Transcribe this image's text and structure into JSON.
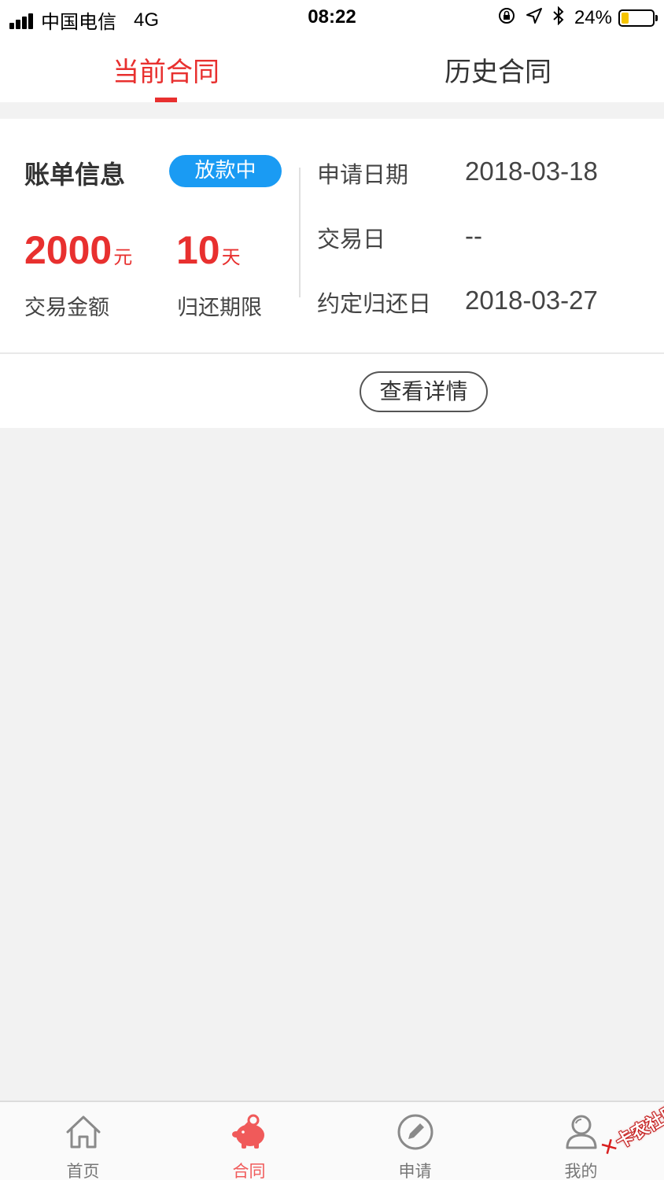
{
  "status_bar": {
    "carrier": "中国电信",
    "network": "4G",
    "time": "08:22",
    "battery_percent": "24%",
    "battery_level": 0.24
  },
  "tabs": [
    {
      "label": "当前合同",
      "active": true
    },
    {
      "label": "历史合同",
      "active": false
    }
  ],
  "bill": {
    "title": "账单信息",
    "status": "放款中",
    "amount_value": "2000",
    "amount_unit": "元",
    "amount_label": "交易金额",
    "term_value": "10",
    "term_unit": "天",
    "term_label": "归还期限",
    "info": [
      {
        "label": "申请日期",
        "value": "2018-03-18"
      },
      {
        "label": "交易日",
        "value": "--"
      },
      {
        "label": "约定归还日",
        "value": "2018-03-27"
      }
    ],
    "detail_button": "查看详情"
  },
  "bottom_nav": [
    {
      "label": "首页",
      "icon": "home-icon",
      "active": false
    },
    {
      "label": "合同",
      "icon": "piggy-bank-icon",
      "active": true
    },
    {
      "label": "申请",
      "icon": "pencil-icon",
      "active": false
    },
    {
      "label": "我的",
      "icon": "user-icon",
      "active": false
    }
  ],
  "watermark": {
    "text": "卡农社区"
  },
  "colors": {
    "accent_red": "#e8302f",
    "badge_blue": "#1a9bf3",
    "nav_active": "#f05a5a",
    "background": "#f2f2f2"
  }
}
